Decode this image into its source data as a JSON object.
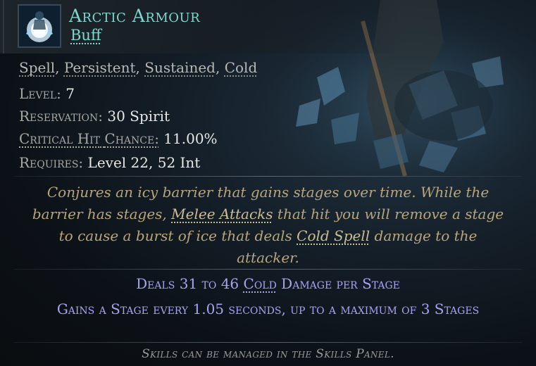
{
  "skill": {
    "name": "Arctic Armour",
    "type": "Buff",
    "icon": "arctic-armour-icon"
  },
  "tags": [
    "Spell",
    "Persistent",
    "Sustained",
    "Cold"
  ],
  "stats": {
    "level_label": "Level:",
    "level_value": "7",
    "reservation_label": "Reservation:",
    "reservation_value": "30 Spirit",
    "crit_label": "Critical Hit",
    "crit_label2": "Chance:",
    "crit_value": "11.00%",
    "requires_label": "Requires:",
    "requires_value": "Level 22, 52 Int"
  },
  "description": {
    "p1": "Conjures an icy barrier that gains stages over time. While the barrier has stages, ",
    "kw1": "Melee Attacks",
    "p2": " that hit you will remove a stage to cause a burst of ice that deals ",
    "kw2": "Cold Spell",
    "p3": " damage to the attacker."
  },
  "modifiers": {
    "line1_a": "Deals 31 to 46 ",
    "line1_kw": "Cold",
    "line1_b": " Damage per Stage",
    "line2": "Gains a Stage every 1.05 seconds, up to a maximum of 3 Stages"
  },
  "footer": "Skills can be managed in the Skills Panel.",
  "colors": {
    "title": "#7fd7d0",
    "flavour": "#b8a67a",
    "modifier": "#a7a4f0",
    "value": "#e8e8e4"
  }
}
